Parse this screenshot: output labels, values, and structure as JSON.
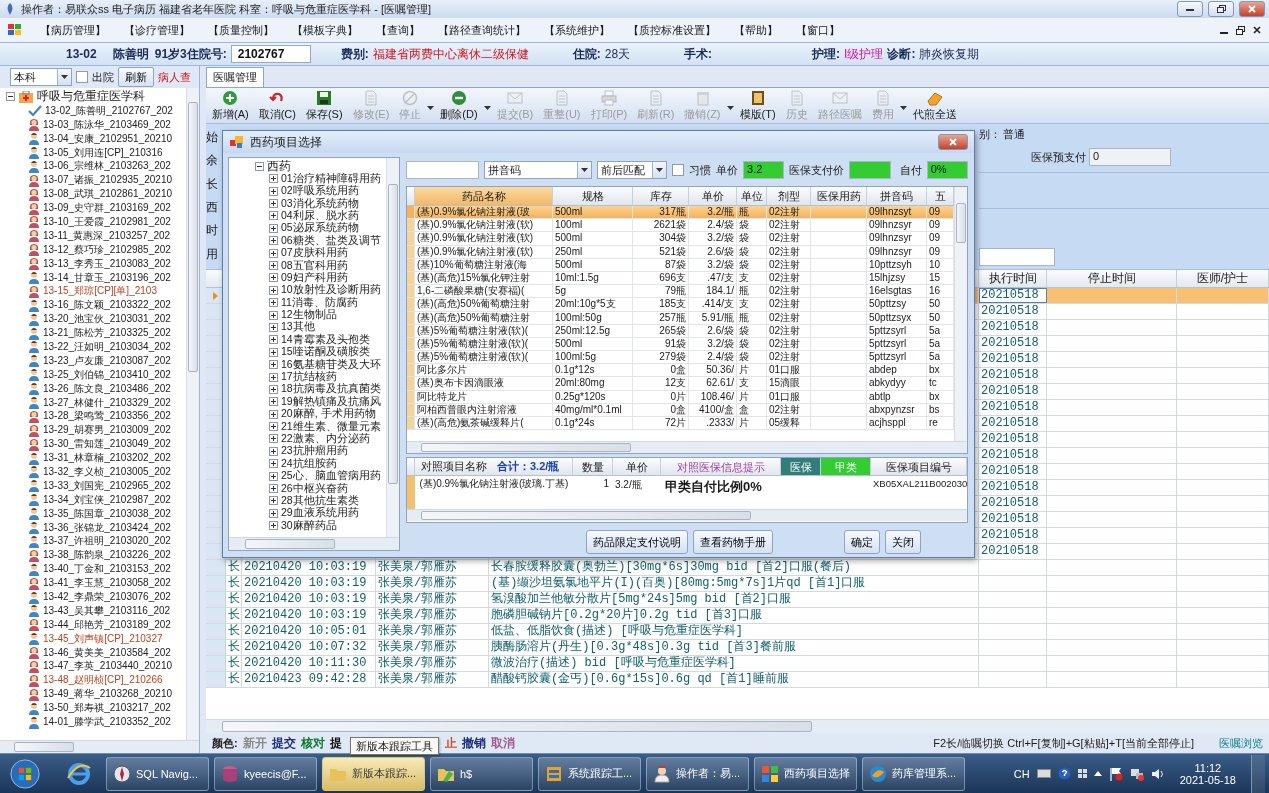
{
  "window": {
    "title": "操作者：易联众ss 电子病历  福建省老年医院  科室：呼吸与危重症医学科 - [医嘱管理]"
  },
  "menu": [
    "【病历管理】",
    "【诊疗管理】",
    "【质量控制】",
    "【模板字典】",
    "【查询】",
    "【路径查询统计】",
    "【系统维护】",
    "【质控标准设置】",
    "【帮助】",
    "【窗口】"
  ],
  "patient_bar": {
    "bed": "13-02",
    "name": "陈善明",
    "age": "91岁",
    "fields": [
      {
        "label": "3住院号:",
        "value": "2102767",
        "kind": "boxed"
      },
      {
        "label": "费别:",
        "value": "福建省两费中心离休二级保健",
        "kind": "alert"
      },
      {
        "label": "住院:",
        "value": "28天",
        "kind": "plain"
      },
      {
        "label": "手术:"
      },
      {
        "label": "护理:",
        "value": "I级护理",
        "kind": "highlight"
      },
      {
        "label": "诊断:",
        "value": "肺炎恢复期",
        "kind": "plain"
      }
    ]
  },
  "left_panel": {
    "scope": "本科",
    "discharged": {
      "label": "出院",
      "checked": false
    },
    "refresh": "刷新",
    "search_label": "病人查",
    "tree": {
      "label": "呼吸与危重症医学科",
      "expanded": true,
      "children": [
        {
          "label": "13-02_陈善明_2102767_202",
          "kind": "checked",
          "flagged": false
        },
        {
          "label": "13-03_陈泳华_2103469_202",
          "kind": "female",
          "flagged": false
        },
        {
          "label": "13-04_安康_2102951_20210",
          "kind": "male",
          "flagged": false
        },
        {
          "label": "13-05_刘用连[CP]_210316",
          "kind": "male",
          "flagged": false
        },
        {
          "label": "13-06_宗维林_2103263_202",
          "kind": "male",
          "flagged": false
        },
        {
          "label": "13-07_诸振_2102935_20210",
          "kind": "female",
          "flagged": false
        },
        {
          "label": "13-08_武琪_2102861_20210",
          "kind": "female",
          "flagged": false
        },
        {
          "label": "13-09_史守群_2103169_202",
          "kind": "female",
          "flagged": false
        },
        {
          "label": "13-10_王爱霞_2102981_202",
          "kind": "female",
          "flagged": false
        },
        {
          "label": "13-11_黄惠深_2103257_202",
          "kind": "female",
          "flagged": false
        },
        {
          "label": "13-12_蔡巧珍_2102985_202",
          "kind": "female",
          "flagged": false
        },
        {
          "label": "13-13_李秀玉_2103083_202",
          "kind": "female",
          "flagged": false
        },
        {
          "label": "13-14_甘章玉_2103196_202",
          "kind": "male",
          "flagged": false
        },
        {
          "label": "13-15_郑琼[CP][单]_2103",
          "kind": "female",
          "flagged": true
        },
        {
          "label": "13-16_陈文颖_2103322_202",
          "kind": "male",
          "flagged": false
        },
        {
          "label": "13-20_池宝伙_2103031_202",
          "kind": "male",
          "flagged": false
        },
        {
          "label": "13-21_陈松芳_2103325_202",
          "kind": "male",
          "flagged": false
        },
        {
          "label": "13-22_汪如明_2103034_202",
          "kind": "male",
          "flagged": false
        },
        {
          "label": "13-23_卢友廉_2103087_202",
          "kind": "male",
          "flagged": false
        },
        {
          "label": "13-25_刘伯锦_2103410_202",
          "kind": "male",
          "flagged": false
        },
        {
          "label": "13-26_陈文良_2103486_202",
          "kind": "male",
          "flagged": false
        },
        {
          "label": "13-27_林健什_2103329_202",
          "kind": "male",
          "flagged": false
        },
        {
          "label": "13-28_梁鸣莺_2103356_202",
          "kind": "female",
          "flagged": false
        },
        {
          "label": "13-29_胡赛男_2103009_202",
          "kind": "female",
          "flagged": false
        },
        {
          "label": "13-30_雷知莲_2103049_202",
          "kind": "female",
          "flagged": false
        },
        {
          "label": "13-31_林章楠_2103202_202",
          "kind": "male",
          "flagged": false
        },
        {
          "label": "13-32_李义桢_2103005_202",
          "kind": "male",
          "flagged": false
        },
        {
          "label": "13-33_刘国宪_2102965_202",
          "kind": "male",
          "flagged": false
        },
        {
          "label": "13-34_刘宝侠_2102987_202",
          "kind": "male",
          "flagged": false
        },
        {
          "label": "13-35_陈国章_2103038_202",
          "kind": "male",
          "flagged": false
        },
        {
          "label": "13-36_张锦龙_2103424_202",
          "kind": "male",
          "flagged": false
        },
        {
          "label": "13-37_许祖明_2103020_202",
          "kind": "male",
          "flagged": false
        },
        {
          "label": "13-38_陈韵泉_2103226_202",
          "kind": "female",
          "flagged": false
        },
        {
          "label": "13-40_丁金和_2103153_202",
          "kind": "male",
          "flagged": false
        },
        {
          "label": "13-41_李玉慧_2103058_202",
          "kind": "female",
          "flagged": false
        },
        {
          "label": "13-42_李鼎荣_2103076_202",
          "kind": "male",
          "flagged": false
        },
        {
          "label": "13-43_吴其攀_2103116_202",
          "kind": "male",
          "flagged": false
        },
        {
          "label": "13-44_邱艳芳_2103189_202",
          "kind": "female",
          "flagged": false
        },
        {
          "label": "13-45_刘声镇[CP]_210327",
          "kind": "male",
          "flagged": true
        },
        {
          "label": "13-46_黄美美_2103584_202",
          "kind": "female",
          "flagged": false
        },
        {
          "label": "13-47_李英_2103440_20210",
          "kind": "female",
          "flagged": false
        },
        {
          "label": "13-48_赵明桢[CP]_210266",
          "kind": "female",
          "flagged": true
        },
        {
          "label": "13-49_蒋华_2103268_20210",
          "kind": "female",
          "flagged": false
        },
        {
          "label": "13-50_郑寿祺_2103217_202",
          "kind": "male",
          "flagged": false
        },
        {
          "label": "14-01_滕学武_2103352_202",
          "kind": "male",
          "flagged": false
        }
      ]
    }
  },
  "tabs": [
    {
      "label": "医嘱管理",
      "selected": true
    }
  ],
  "toolbar": [
    {
      "label": "新增(A)",
      "disabled": false,
      "has_menu": false
    },
    {
      "label": "取消(C)",
      "disabled": false,
      "has_menu": false
    },
    {
      "label": "保存(S)",
      "disabled": false,
      "has_menu": false
    },
    {
      "label": "修改(E)",
      "disabled": true,
      "has_menu": false
    },
    {
      "label": "停止",
      "disabled": true,
      "has_menu": true
    },
    {
      "label": "删除(D)",
      "disabled": false,
      "has_menu": true
    },
    {
      "label": "提交(B)",
      "disabled": true,
      "has_menu": false
    },
    {
      "label": "重整(U)",
      "disabled": true,
      "has_menu": false
    },
    {
      "label": "打印(P)",
      "disabled": true,
      "has_menu": false
    },
    {
      "label": "刷新(R)",
      "disabled": true,
      "has_menu": false
    },
    {
      "label": "撤销(Z)",
      "disabled": true,
      "has_menu": true
    },
    {
      "label": "模版(T)",
      "disabled": false,
      "has_menu": false
    },
    {
      "label": "历史",
      "disabled": true,
      "has_menu": false
    },
    {
      "label": "路径医嘱",
      "disabled": true,
      "has_menu": false
    },
    {
      "label": "费用",
      "disabled": true,
      "has_menu": true
    },
    {
      "label": "代煎全送",
      "disabled": false,
      "has_menu": false
    }
  ],
  "order_form": {
    "fragments": [
      "始",
      "余",
      "长",
      "西",
      "时",
      "用"
    ],
    "category_label": "别：",
    "category": "普通",
    "prepay_label": "医保预支付",
    "prepay": "0"
  },
  "orders": {
    "columns": [
      "执行时间",
      "停止时间",
      "医师/护士"
    ],
    "rows": [
      {
        "exec_time": "20210518",
        "selected": true
      },
      {
        "exec_time": "20210518",
        "selected": false
      },
      {
        "exec_time": "20210518",
        "selected": false
      },
      {
        "exec_time": "20210518",
        "selected": false
      },
      {
        "exec_time": "20210518",
        "selected": false
      },
      {
        "exec_time": "20210518",
        "selected": false
      },
      {
        "exec_time": "20210518",
        "selected": false
      },
      {
        "exec_time": "20210518",
        "selected": false
      },
      {
        "exec_time": "20210518",
        "selected": false
      },
      {
        "exec_time": "20210518",
        "selected": false
      },
      {
        "exec_time": "20210518",
        "selected": false
      },
      {
        "exec_time": "20210518",
        "selected": false
      },
      {
        "exec_time": "20210518",
        "selected": false
      },
      {
        "exec_time": "20210518",
        "selected": false
      },
      {
        "exec_time": "20210518",
        "selected": false
      },
      {
        "exec_time": "20210518",
        "selected": false
      },
      {
        "exec_time": "20210518",
        "selected": false
      },
      {
        "type": "长",
        "start_time": "20210420 10:03:19",
        "doctor": "张美泉/郭雁苏",
        "content": "长春胺缓释胶囊(奥勃兰)[30mg*6s]30mg bid [首2]口服(餐后)",
        "selected": false
      },
      {
        "type": "长",
        "start_time": "20210420 10:03:19",
        "doctor": "张美泉/郭雁苏",
        "content": "(基)缬沙坦氨氯地平片(I)(百奥)[80mg:5mg*7s]1片qd [首1]口服",
        "selected": false
      },
      {
        "type": "长",
        "start_time": "20210420 10:03:19",
        "doctor": "张美泉/郭雁苏",
        "content": "氢溴酸加兰他敏分散片[5mg*24s]5mg bid [首2]口服",
        "selected": false
      },
      {
        "type": "长",
        "start_time": "20210420 10:03:19",
        "doctor": "张美泉/郭雁苏",
        "content": "胞磷胆碱钠片[0.2g*20片]0.2g tid [首3]口服",
        "selected": false
      },
      {
        "type": "长",
        "start_time": "20210420 10:05:01",
        "doctor": "张美泉/郭雁苏",
        "content": "低盐、低脂饮食(描述)    [呼吸与危重症医学科]",
        "selected": false
      },
      {
        "type": "长",
        "start_time": "20210420 10:07:32",
        "doctor": "张美泉/郭雁苏",
        "content": "胰酶肠溶片(丹生)[0.3g*48s]0.3g tid [首3]餐前服",
        "selected": false
      },
      {
        "type": "长",
        "start_time": "20210420 10:11:30",
        "doctor": "张美泉/郭雁苏",
        "content": "微波治疗(描述)  bid  [呼吸与危重症医学科]",
        "selected": false
      },
      {
        "type": "长",
        "start_time": "20210423 09:42:28",
        "doctor": "张美泉/郭雁苏",
        "content": "醋酸钙胶囊(金丐)[0.6g*15s]0.6g qd [首1]睡前服",
        "selected": false
      }
    ]
  },
  "dialog": {
    "title": "西药项目选择",
    "tree": {
      "label": "西药",
      "expanded": true,
      "children": [
        {
          "label": "01治疗精神障碍用药",
          "expanded": false
        },
        {
          "label": "02呼吸系统用药",
          "expanded": false
        },
        {
          "label": "03消化系统药物",
          "expanded": false
        },
        {
          "label": "04利尿、脱水药",
          "expanded": false
        },
        {
          "label": "05泌尿系统药物",
          "expanded": false
        },
        {
          "label": "06糖类、盐类及调节",
          "expanded": false
        },
        {
          "label": "07皮肤科用药",
          "expanded": false
        },
        {
          "label": "08五官科用药",
          "expanded": false
        },
        {
          "label": "09妇产科用药",
          "expanded": false
        },
        {
          "label": "10放射性及诊断用药",
          "expanded": false
        },
        {
          "label": "11消毒、防腐药",
          "expanded": false
        },
        {
          "label": "12生物制品",
          "expanded": false
        },
        {
          "label": "13其他",
          "expanded": false
        },
        {
          "label": "14青霉素及头孢类",
          "expanded": false
        },
        {
          "label": "15喹诺酮及磺胺类",
          "expanded": false
        },
        {
          "label": "16氨基糖苷类及大环",
          "expanded": false
        },
        {
          "label": "17抗结核药",
          "expanded": false
        },
        {
          "label": "18抗病毒及抗真菌类",
          "expanded": false
        },
        {
          "label": "19解热镇痛及抗痛风",
          "expanded": false
        },
        {
          "label": "20麻醉, 手术用药物",
          "expanded": false
        },
        {
          "label": "21维生素、微量元素",
          "expanded": false
        },
        {
          "label": "22激素、内分泌药",
          "expanded": false
        },
        {
          "label": "23抗肿瘤用药",
          "expanded": false
        },
        {
          "label": "24抗组胺药",
          "expanded": false
        },
        {
          "label": "25心、脑血管病用药",
          "expanded": false
        },
        {
          "label": "26中枢兴奋药",
          "expanded": false
        },
        {
          "label": "28其他抗生素类",
          "expanded": false
        },
        {
          "label": "29血液系统用药",
          "expanded": false
        },
        {
          "label": "30麻醉药品",
          "expanded": false
        }
      ]
    },
    "filter": {
      "code_type": "拼音码",
      "match": "前后匹配",
      "habit": {
        "label": "习惯",
        "checked": false
      },
      "price_label": "单价",
      "price": "3.2",
      "insurance_price_label": "医保支付价",
      "self_pay_label": "自付",
      "self_pay": "0%"
    },
    "drug_table": {
      "columns": [
        "药品名称",
        "规格",
        "库存",
        "单价",
        "单位",
        "剂型",
        "医保用药",
        "拼音码",
        "五"
      ],
      "rows": [
        {
          "name": "(基)0.9%氯化钠注射液(玻",
          "spec": "500ml",
          "stock": "317瓶",
          "price": "3.2/瓶",
          "unit": "瓶",
          "form": "02注射",
          "pinyin": "09lhnzsyt",
          "column_9": "09",
          "selected": true
        },
        {
          "name": "(基)0.9%氯化钠注射液(软)",
          "spec": "100ml",
          "stock": "2621袋",
          "price": "2.4/袋",
          "unit": "袋",
          "form": "02注射",
          "pinyin": "09lhnzsyr",
          "column_9": "09",
          "selected": false
        },
        {
          "name": "(基)0.9%氯化钠注射液(软)",
          "spec": "500ml",
          "stock": "304袋",
          "price": "3.2/袋",
          "unit": "袋",
          "form": "02注射",
          "pinyin": "09lhnzsyr",
          "column_9": "09",
          "selected": false
        },
        {
          "name": "(基)0.9%氯化钠注射液(软)",
          "spec": "250ml",
          "stock": "521袋",
          "price": "2.6/袋",
          "unit": "袋",
          "form": "02注射",
          "pinyin": "09lhnzsyr",
          "column_9": "09",
          "selected": false
        },
        {
          "name": "(基)10%葡萄糖注射液(海",
          "spec": "500ml",
          "stock": "87袋",
          "price": "3.2/袋",
          "unit": "袋",
          "form": "02注射",
          "pinyin": "10pttzsyh",
          "column_9": "10",
          "selected": false
        },
        {
          "name": "(基)(高危)15%氯化钾注射",
          "spec": "10ml:1.5g",
          "stock": "696支",
          "price": ".47/支",
          "unit": "支",
          "form": "02注射",
          "pinyin": "15lhjzsy",
          "column_9": "15",
          "selected": false
        },
        {
          "name": "1,6-二磷酸果糖(安赛福)(",
          "spec": "5g",
          "stock": "79瓶",
          "price": "184.1/",
          "unit": "瓶",
          "form": "02注射",
          "pinyin": "16elsgtas",
          "column_9": "16",
          "selected": false
        },
        {
          "name": "(基)(高危)50%葡萄糖注射",
          "spec": "20ml:10g*5支",
          "stock": "185支",
          "price": ".414/支",
          "unit": "支",
          "form": "02注射",
          "pinyin": "50pttzsy",
          "column_9": "50",
          "selected": false
        },
        {
          "name": "(基)(高危)50%葡萄糖注射",
          "spec": "100ml:50g",
          "stock": "257瓶",
          "price": "5.91/瓶",
          "unit": "瓶",
          "form": "02注射",
          "pinyin": "50pttzsyx",
          "column_9": "50",
          "selected": false
        },
        {
          "name": "(基)5%葡萄糖注射液(软)(",
          "spec": "250ml:12.5g",
          "stock": "265袋",
          "price": "2.6/袋",
          "unit": "袋",
          "form": "02注射",
          "pinyin": "5pttzsyrl",
          "column_9": "5a",
          "selected": false
        },
        {
          "name": "(基)5%葡萄糖注射液(软)(",
          "spec": "500ml",
          "stock": "91袋",
          "price": "3.2/袋",
          "unit": "袋",
          "form": "02注射",
          "pinyin": "5pttzsyrl",
          "column_9": "5a",
          "selected": false
        },
        {
          "name": "(基)5%葡萄糖注射液(软)(",
          "spec": "100ml:5g",
          "stock": "279袋",
          "price": "2.4/袋",
          "unit": "袋",
          "form": "02注射",
          "pinyin": "5pttzsyrl",
          "column_9": "5a",
          "selected": false
        },
        {
          "name": "阿比多尔片",
          "spec": "0.1g*12s",
          "stock": "0盒",
          "price": "50.36/",
          "unit": "片",
          "form": "01口服",
          "pinyin": "abdep",
          "column_9": "bx",
          "selected": false
        },
        {
          "name": "(基)奥布卡因滴眼液",
          "spec": "20ml:80mg",
          "stock": "12支",
          "price": "62.61/",
          "unit": "支",
          "form": "15滴眼",
          "pinyin": "abkydyy",
          "column_9": "tc",
          "selected": false
        },
        {
          "name": "阿比特龙片",
          "spec": "0.25g*120s",
          "stock": "0片",
          "price": "108.46/",
          "unit": "片",
          "form": "01口服",
          "pinyin": "abtlp",
          "column_9": "bx",
          "selected": false
        },
        {
          "name": "阿柏西普眼内注射溶液",
          "spec": "40mg/ml*0.1ml",
          "stock": "0盒",
          "price": "4100/盒",
          "unit": "盒",
          "form": "02注射",
          "pinyin": "abxpynzsr",
          "column_9": "bs",
          "selected": false
        },
        {
          "name": "(基)(高危)氨茶碱缓释片(",
          "spec": "0.1g*24s",
          "stock": "72片",
          "price": ".2333/",
          "unit": "片",
          "form": "05缓释",
          "pinyin": "acjhsppl",
          "column_9": "re",
          "selected": false
        }
      ]
    },
    "summary": {
      "name_header": "对照项目名称",
      "total": "合计：3.2/瓶",
      "qty_header": "数量",
      "price_header": "单价",
      "note_header": "对照医保信息提示",
      "insurance_header": "医保",
      "class_header": "甲类",
      "code_header": "医保项目编号",
      "row": {
        "name": "(基)0.9%氯化钠注射液(玻璃.丁基)",
        "qty": "1",
        "price": "3.2/瓶",
        "note": "甲类自付比例0%",
        "code": "XB05XAL211B002030"
      }
    },
    "buttons": [
      "药品限定支付说明",
      "查看药物手册",
      "确定",
      "关闭"
    ]
  },
  "status_bar": {
    "legend_label": "颜色:",
    "legend": [
      {
        "label": "新开",
        "color": "#8a8a8a"
      },
      {
        "label": "提交",
        "color": "#1b2f7e"
      },
      {
        "label": "核对",
        "color": "#0a7a2a"
      },
      {
        "label": "提",
        "color": "#111111"
      },
      {
        "label": "止",
        "color": "#c8501e"
      },
      {
        "label": "撤销",
        "color": "#1b2f7e"
      },
      {
        "label": "取消",
        "color": "#a05a90"
      }
    ],
    "shortcuts": "F2长/临嘱切换 Ctrl+F[复制]+G[粘贴]+T[当前全部停止]",
    "browse": "医嘱浏览"
  },
  "tooltip": {
    "text": "新版本跟踪工具"
  },
  "taskbar": {
    "items": [
      {
        "label": "SQL Navig...",
        "selected": false
      },
      {
        "label": "kyeecis@F...",
        "selected": false
      },
      {
        "label": "新版本跟踪...",
        "selected": true
      },
      {
        "label": "h$",
        "selected": false
      },
      {
        "label": "系统跟踪工...",
        "selected": false
      },
      {
        "label": "操作者：易...",
        "selected": false
      },
      {
        "label": "西药项目选择",
        "selected": false
      },
      {
        "label": "药库管理系...",
        "selected": false
      }
    ],
    "lang": "CH",
    "time": "11:12",
    "date": "2021-05-18"
  }
}
